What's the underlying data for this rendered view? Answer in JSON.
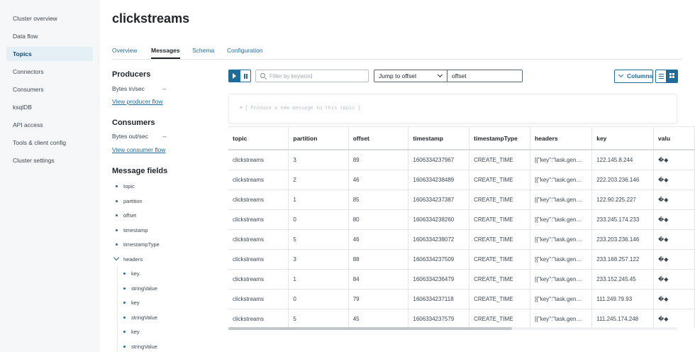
{
  "sidebar": {
    "items": [
      {
        "label": "Cluster overview"
      },
      {
        "label": "Data flow"
      },
      {
        "label": "Topics",
        "active": true
      },
      {
        "label": "Connectors"
      },
      {
        "label": "Consumers"
      },
      {
        "label": "ksqlDB"
      },
      {
        "label": "API access"
      },
      {
        "label": "Tools & client config"
      },
      {
        "label": "Cluster settings"
      }
    ]
  },
  "header": {
    "title": "clickstreams"
  },
  "tabs": [
    {
      "label": "Overview"
    },
    {
      "label": "Messages",
      "active": true
    },
    {
      "label": "Schema"
    },
    {
      "label": "Configuration"
    }
  ],
  "producers": {
    "title": "Producers",
    "bytes_label": "Bytes in/sec",
    "bytes_value": "--",
    "link": "View producer flow"
  },
  "consumers": {
    "title": "Consumers",
    "bytes_label": "Bytes out/sec",
    "bytes_value": "--",
    "link": "View consumer flow"
  },
  "message_fields": {
    "title": "Message fields",
    "fields": [
      "topic",
      "partition",
      "offset",
      "timestamp",
      "timestampType"
    ],
    "headers_label": "headers",
    "header_children": [
      "key",
      "stringValue",
      "key",
      "stringValue",
      "key",
      "stringValue"
    ]
  },
  "toolbar": {
    "search_placeholder": "Filter by keyword",
    "jump_label": "Jump to offset",
    "offset_value": "offset",
    "columns_label": "Columns"
  },
  "produce": {
    "plus": "+",
    "text": "{ Produce a new message to this topic }"
  },
  "table": {
    "columns": [
      "topic",
      "partition",
      "offset",
      "timestamp",
      "timestampType",
      "headers",
      "key",
      "valu"
    ],
    "rows": [
      [
        "clickstreams",
        "3",
        "89",
        "1606334237967",
        "CREATE_TIME",
        "[{\"key\":\"task.gen…",
        "122.145.8.244",
        "�◆"
      ],
      [
        "clickstreams",
        "2",
        "46",
        "1606334238489",
        "CREATE_TIME",
        "[{\"key\":\"task.gen…",
        "222.203.236.146",
        "�◆"
      ],
      [
        "clickstreams",
        "1",
        "85",
        "1606334237387",
        "CREATE_TIME",
        "[{\"key\":\"task.gen…",
        "122.90.225.227",
        "�◆"
      ],
      [
        "clickstreams",
        "0",
        "80",
        "1606334238260",
        "CREATE_TIME",
        "[{\"key\":\"task.gen…",
        "233.245.174.233",
        "�◆"
      ],
      [
        "clickstreams",
        "5",
        "46",
        "1606334238072",
        "CREATE_TIME",
        "[{\"key\":\"task.gen…",
        "233.203.236.146",
        "�◆"
      ],
      [
        "clickstreams",
        "3",
        "88",
        "1606334237509",
        "CREATE_TIME",
        "[{\"key\":\"task.gen…",
        "233.168.257.122",
        "�◆"
      ],
      [
        "clickstreams",
        "1",
        "84",
        "1606334236479",
        "CREATE_TIME",
        "[{\"key\":\"task.gen…",
        "233.152.245.45",
        "�◆"
      ],
      [
        "clickstreams",
        "0",
        "79",
        "1606334237118",
        "CREATE_TIME",
        "[{\"key\":\"task.gen…",
        "111.249.79.93",
        "�◆"
      ],
      [
        "clickstreams",
        "5",
        "45",
        "1606334237579",
        "CREATE_TIME",
        "[{\"key\":\"task.gen…",
        "111.245.174.248",
        "�◆"
      ]
    ]
  }
}
